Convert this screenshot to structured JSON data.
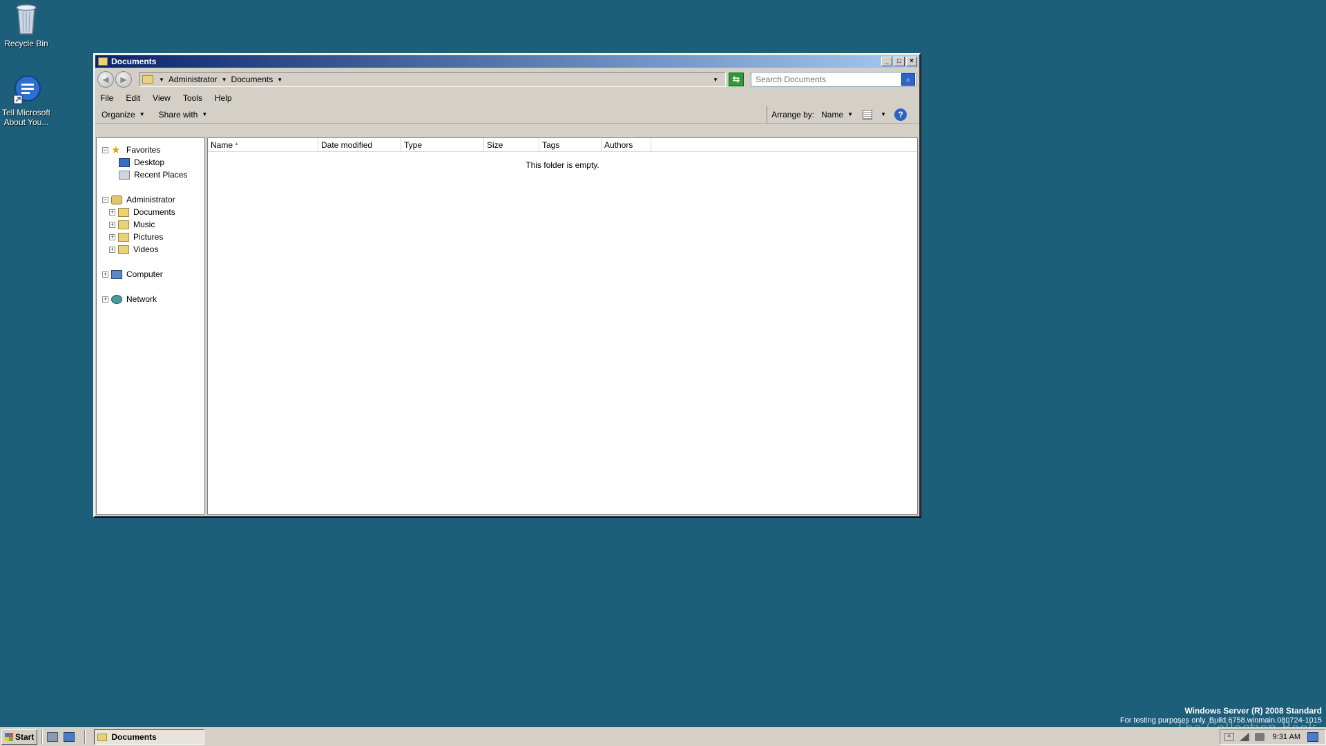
{
  "desktop": {
    "icons": [
      {
        "label": "Recycle Bin",
        "icon": "recycle-bin-icon"
      },
      {
        "label": "Tell Microsoft About You...",
        "icon": "feedback-icon"
      }
    ]
  },
  "window": {
    "title": "Documents",
    "controls": {
      "minimize": "_",
      "maximize": "□",
      "close": "×"
    },
    "address": {
      "crumbs": [
        "Administrator",
        "Documents"
      ]
    },
    "search": {
      "placeholder": "Search Documents"
    },
    "menu": [
      "File",
      "Edit",
      "View",
      "Tools",
      "Help"
    ],
    "commands": {
      "organize": "Organize",
      "share_with": "Share with",
      "arrange_label": "Arrange by:",
      "arrange_value": "Name"
    },
    "nav": {
      "favorites": "Favorites",
      "desktop": "Desktop",
      "recent_places": "Recent Places",
      "administrator": "Administrator",
      "documents": "Documents",
      "music": "Music",
      "pictures": "Pictures",
      "videos": "Videos",
      "computer": "Computer",
      "network": "Network"
    },
    "columns": [
      "Name",
      "Date modified",
      "Type",
      "Size",
      "Tags",
      "Authors"
    ],
    "empty_message": "This folder is empty."
  },
  "watermark": {
    "title": "Windows Server (R) 2008 Standard",
    "build": "For testing purposes only. Build 6758.winmain.080724-1015",
    "logo": "The Collection Book"
  },
  "taskbar": {
    "start": "Start",
    "task": "Documents",
    "clock": "9:31 AM"
  },
  "colors": {
    "desktop": "#1d5e7a",
    "titlebar_start": "#0a246a",
    "titlebar_end": "#a6caf0"
  }
}
